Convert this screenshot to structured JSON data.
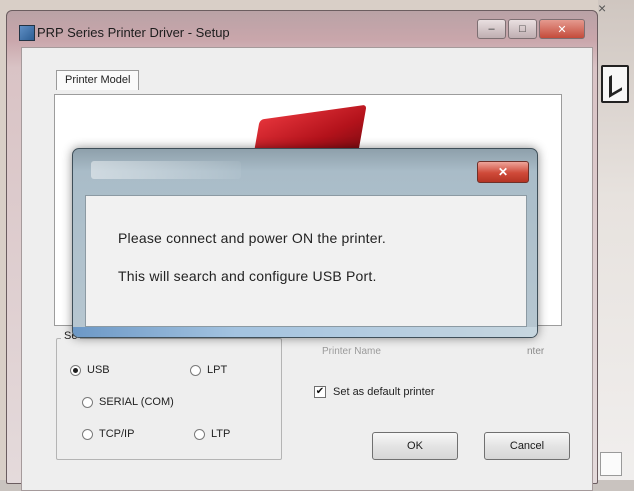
{
  "window": {
    "title": "PRP Series Printer Driver - Setup",
    "controls": [
      "–",
      "□",
      "✕"
    ]
  },
  "tabs": [
    "Printer Model"
  ],
  "port_group": {
    "label": "Se",
    "options": [
      {
        "label": "USB",
        "selected": true
      },
      {
        "label": "LPT",
        "selected": false
      },
      {
        "label": "SERIAL (COM)",
        "selected": false
      },
      {
        "label": "TCP/IP",
        "selected": false
      },
      {
        "label": "LTP",
        "selected": false
      }
    ]
  },
  "right_panel": {
    "partial_text": "Printer Name",
    "partial_text_2": "nter"
  },
  "default_printer": {
    "label": "Set as default printer",
    "checked": true,
    "mark": "✔"
  },
  "buttons": {
    "ok": "OK",
    "cancel": "Cancel"
  },
  "dialog": {
    "close_label": "✕",
    "line1": "Please connect and power ON the printer.",
    "line2": "This will search and configure USB Port."
  },
  "colors": {
    "accent_red": "#cf4a39",
    "printer_red": "#b3121b"
  }
}
